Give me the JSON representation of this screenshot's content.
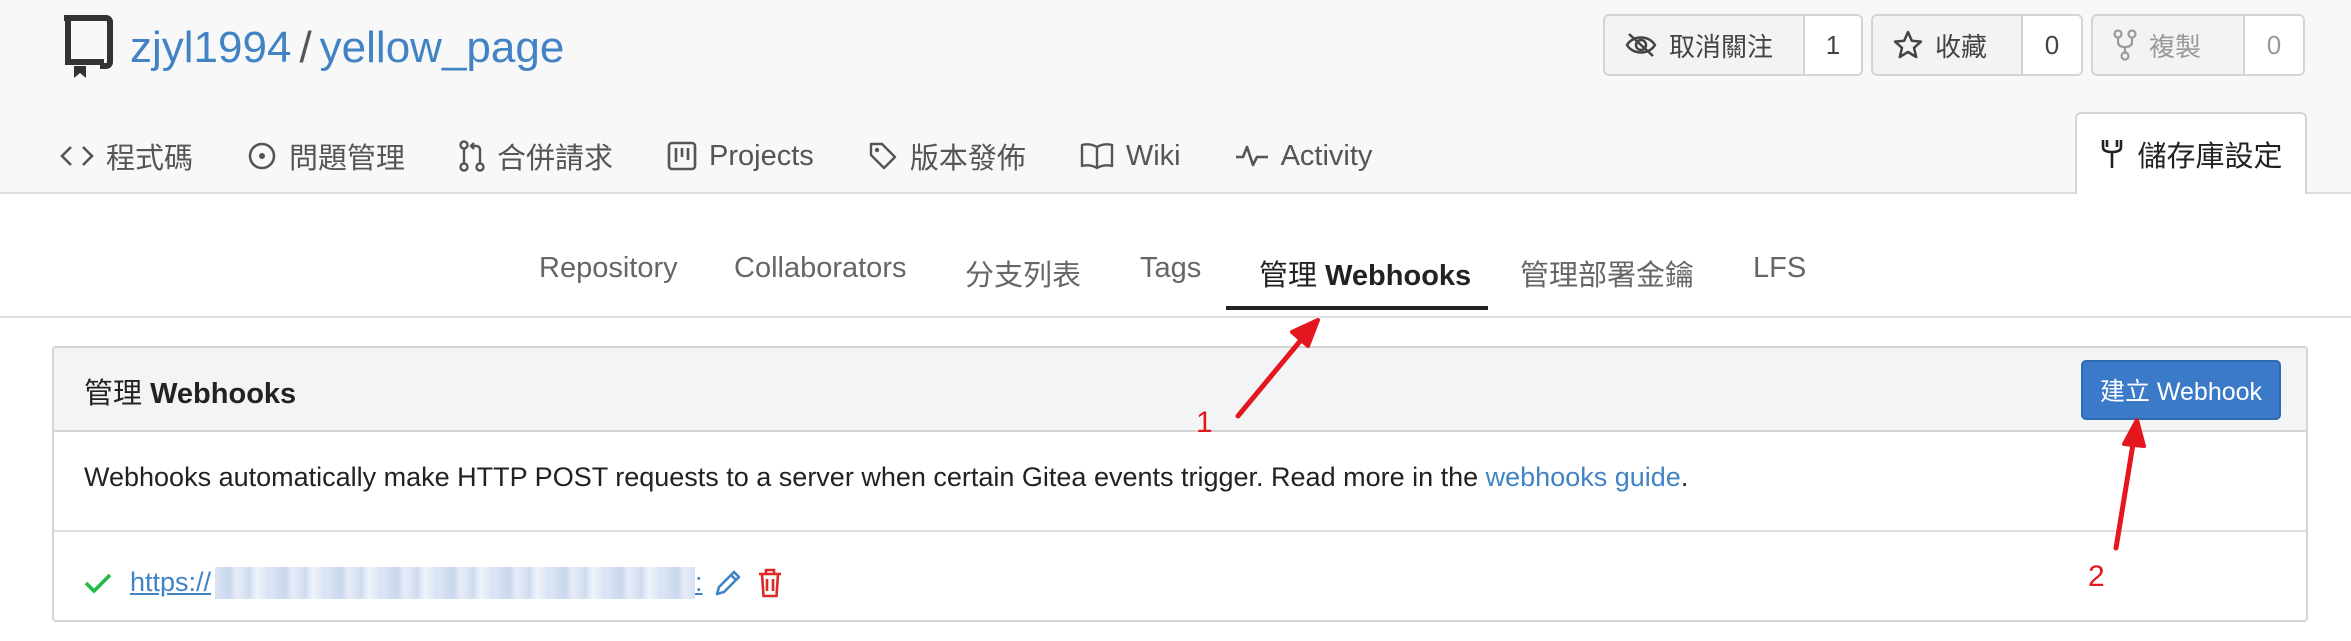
{
  "repo": {
    "owner": "zjyl1994",
    "separator": "/",
    "name": "yellow_page"
  },
  "actions": {
    "unwatch": {
      "label": "取消關注",
      "count": "1",
      "icon": "eye-slash-icon"
    },
    "star": {
      "label": "收藏",
      "count": "0",
      "icon": "star-icon"
    },
    "fork": {
      "label": "複製",
      "count": "0",
      "icon": "fork-icon"
    }
  },
  "tabs": [
    {
      "label": "程式碼",
      "icon": "code-icon"
    },
    {
      "label": "問題管理",
      "icon": "issue-icon"
    },
    {
      "label": "合併請求",
      "icon": "pull-request-icon"
    },
    {
      "label": "Projects",
      "icon": "project-icon"
    },
    {
      "label": "版本發佈",
      "icon": "tag-icon"
    },
    {
      "label": "Wiki",
      "icon": "book-icon"
    },
    {
      "label": "Activity",
      "icon": "pulse-icon"
    }
  ],
  "settings_tab": {
    "label": "儲存庫設定",
    "icon": "tool-icon"
  },
  "subtabs": [
    {
      "label": "Repository"
    },
    {
      "label": "Collaborators"
    },
    {
      "label": "分支列表"
    },
    {
      "label": "Tags"
    },
    {
      "prefix": "管理",
      "label": "Webhooks"
    },
    {
      "label": "管理部署金鑰"
    },
    {
      "label": "LFS"
    }
  ],
  "panel": {
    "title_prefix": "管理",
    "title_main": "Webhooks",
    "create_button": "建立 Webhook",
    "description_text": "Webhooks automatically make HTTP POST requests to a server when certain Gitea events trigger. Read more in the ",
    "description_link": "webhooks guide",
    "description_end": "."
  },
  "webhooks": [
    {
      "url_prefix": "https://",
      "url_suffix": ":",
      "status": "success"
    }
  ],
  "annotations": [
    {
      "number": "1"
    },
    {
      "number": "2"
    }
  ],
  "colors": {
    "link": "#4183c4",
    "primary_button": "#3a7ac8",
    "annotation": "#e4161e",
    "success": "#21ba45",
    "danger": "#db2828"
  }
}
